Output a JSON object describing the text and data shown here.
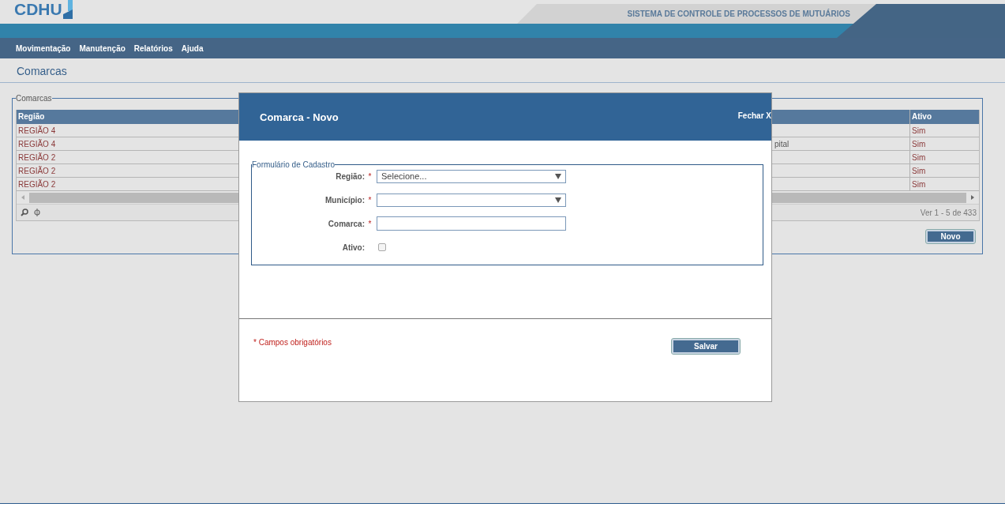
{
  "header": {
    "logo": "CDHU",
    "system_title": "SISTEMA DE CONTROLE DE PROCESSOS DE MUTUÁRIOS"
  },
  "menu": [
    "Movimentação",
    "Manutenção",
    "Relatórios",
    "Ajuda"
  ],
  "page_title": "Comarcas",
  "panel": {
    "legend": "Comarcas",
    "table": {
      "columns": [
        "Região",
        "Ativo"
      ],
      "rows": [
        {
          "regiao": "REGIÃO 4",
          "ativo": "Sim"
        },
        {
          "regiao": "REGIÃO 4",
          "column_2": "pital",
          "ativo": "Sim"
        },
        {
          "regiao": "REGIÃO 2",
          "ativo": "Sim"
        },
        {
          "regiao": "REGIÃO 2",
          "ativo": "Sim"
        },
        {
          "regiao": "REGIÃO 2",
          "ativo": "Sim"
        }
      ],
      "pager": "Ver 1 - 5 de 433"
    },
    "new_button": "Novo"
  },
  "modal": {
    "title": "Comarca - Novo",
    "close": "Fechar X",
    "legend": "Formulário de Cadastro",
    "fields": [
      {
        "kind": "select",
        "label": "Região:",
        "required": true,
        "value": "Selecione..."
      },
      {
        "kind": "select",
        "label": "Município:",
        "required": true
      },
      {
        "kind": "text",
        "label": "Comarca:",
        "required": true
      },
      {
        "kind": "checkbox",
        "label": "Ativo:",
        "required": false,
        "checked": false
      }
    ],
    "required_mark": "*",
    "required_note": "* Campos obrigatórios",
    "save_button": "Salvar"
  }
}
